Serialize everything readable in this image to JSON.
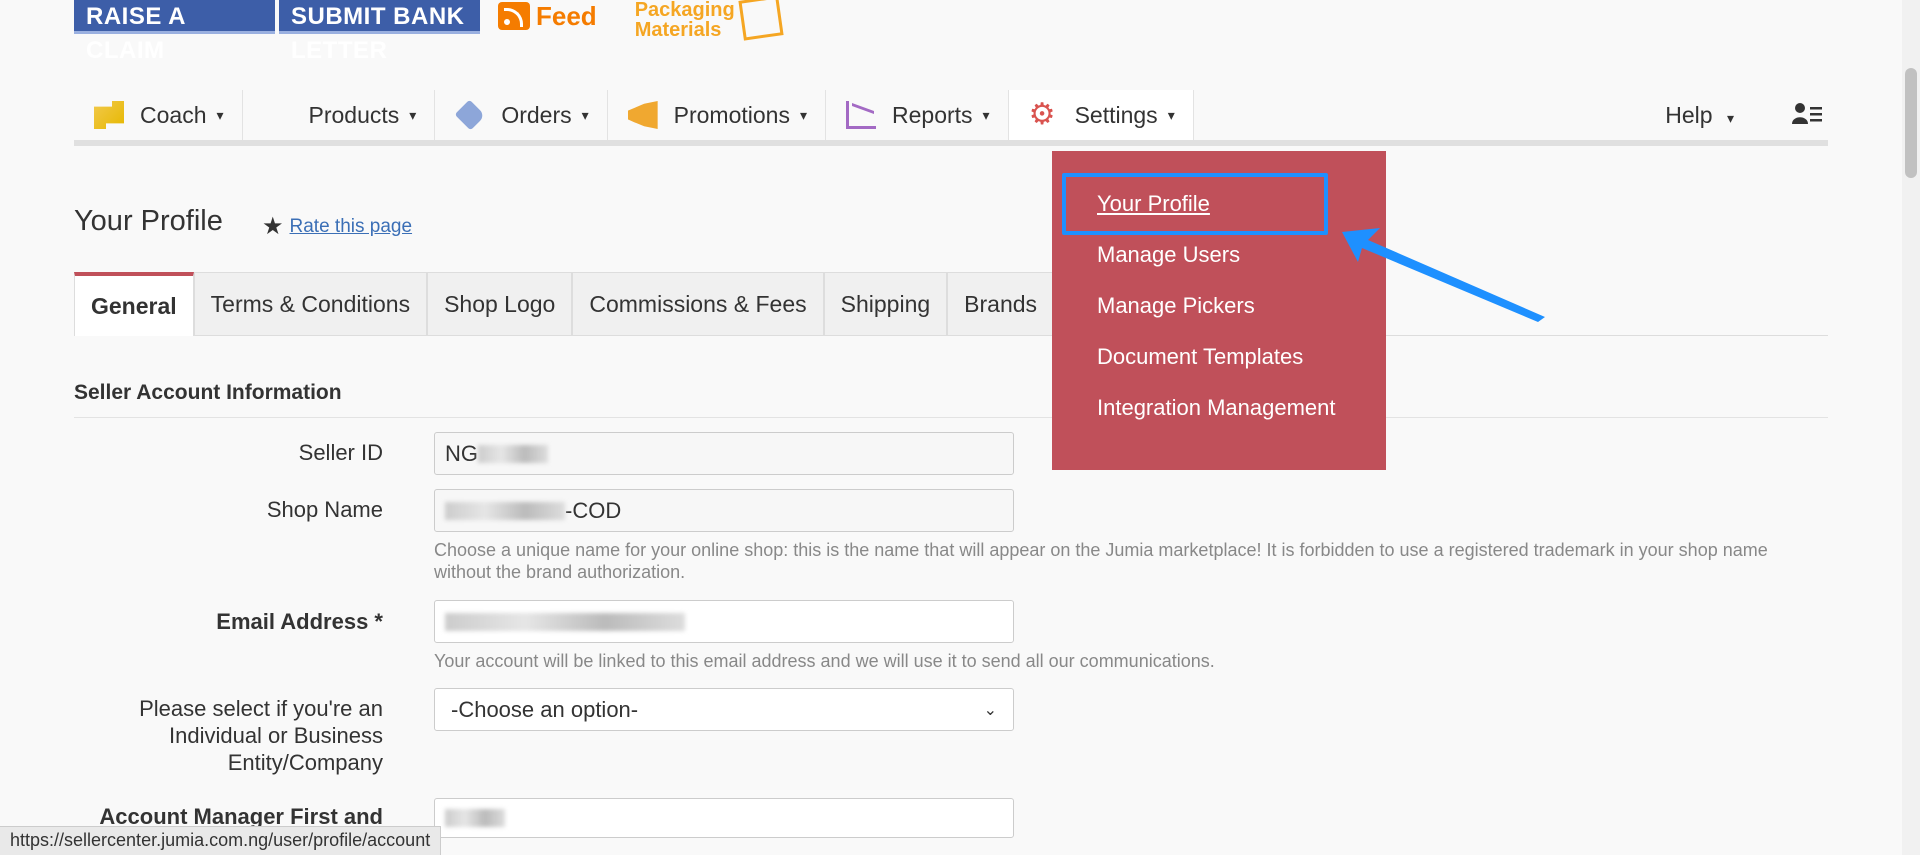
{
  "banners": {
    "raise_claim": "RAISE A CLAIM",
    "submit_bank_letter": "SUBMIT BANK LETTER",
    "feed": "Feed",
    "packaging_line1": "Packaging",
    "packaging_line2": "Materials"
  },
  "nav": {
    "coach": "Coach",
    "products": "Products",
    "orders": "Orders",
    "promotions": "Promotions",
    "reports": "Reports",
    "settings": "Settings",
    "help": "Help",
    "caret": "▾"
  },
  "page": {
    "title": "Your Profile",
    "rate": "Rate this page"
  },
  "tabs": [
    "General",
    "Terms & Conditions",
    "Shop Logo",
    "Commissions & Fees",
    "Shipping",
    "Brands"
  ],
  "section": {
    "title": "Seller Account Information"
  },
  "form": {
    "seller_id_label": "Seller ID",
    "seller_id_value": "NG",
    "shop_name_label": "Shop Name",
    "shop_name_value": "-COD",
    "shop_name_help": "Choose a unique name for your online shop: this is the name that will appear on the Jumia marketplace! It is forbidden to use a registered trademark in your shop name without the brand authorization.",
    "email_label": "Email Address *",
    "email_help": "Your account will be linked to this email address and we will use it to send all our communications.",
    "entity_label_1": "Please select if you're an",
    "entity_label_2": "Individual or Business",
    "entity_label_3": "Entity/Company",
    "entity_value": "-Choose an option-",
    "manager_label": "Account Manager First and"
  },
  "dropdown": {
    "items": [
      "Your Profile",
      "Manage Users",
      "Manage Pickers",
      "Document Templates",
      "Integration Management"
    ]
  },
  "status_url": "https://sellercenter.jumia.com.ng/user/profile/account",
  "colors": {
    "accent": "#c0505a",
    "banner_blue": "#3d5ea8",
    "highlight": "#1e90ff"
  }
}
